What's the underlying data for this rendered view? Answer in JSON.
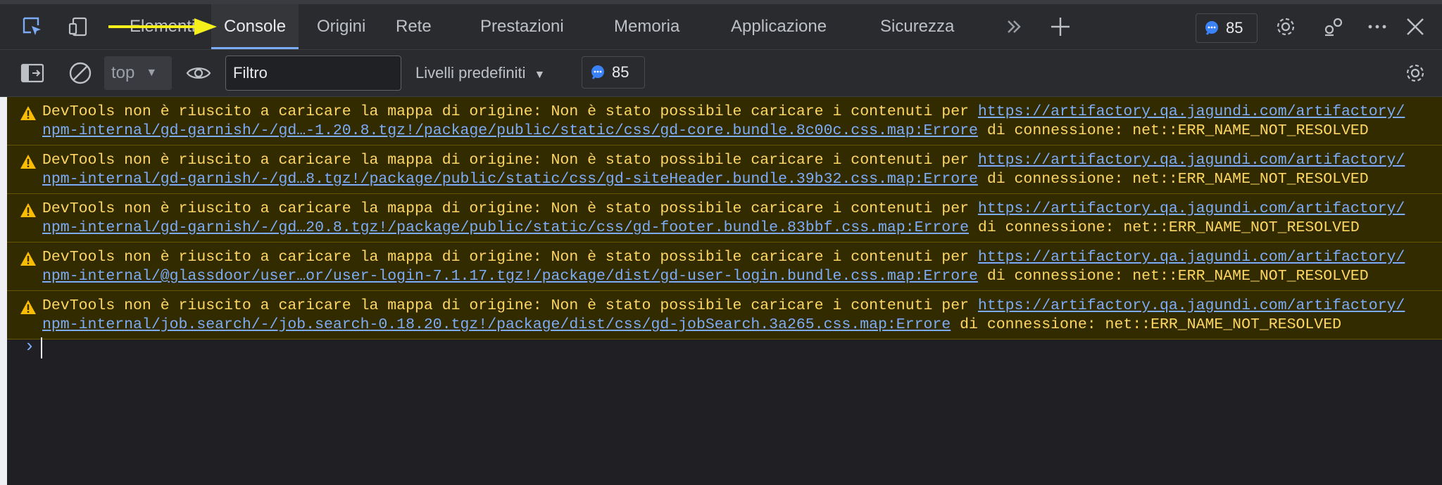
{
  "tabs": [
    {
      "label": "Elementi"
    },
    {
      "label": "Console"
    },
    {
      "label": "Origini"
    },
    {
      "label": "Rete"
    },
    {
      "label": "Prestazioni"
    },
    {
      "label": "Memoria"
    },
    {
      "label": "Applicazione"
    },
    {
      "label": "Sicurezza"
    }
  ],
  "header": {
    "issues_count": "85",
    "icons": [
      "inspect-icon",
      "device-toggle-icon",
      "more-tabs-icon",
      "add-tab-icon",
      "issues-icon",
      "settings-icon",
      "customize-icon",
      "more-options-icon",
      "close-icon"
    ]
  },
  "toolbar": {
    "context": "top",
    "filter_placeholder": "Filtro",
    "levels": "Livelli predefiniti",
    "issues_count": "85"
  },
  "messages": [
    {
      "prefix": "DevTools non è riuscito a caricare la mappa di origine: Non è stato possibile caricare i contenuti per ",
      "link": "https://artifactory.qa.jagundi.com/artifactory/npm-internal/gd-garnish/-/gd…-1.20.8.tgz!/package/public/static/css/gd-core.bundle.8c00c.css.map:Errore",
      "suffix": " di connessione: net::ERR_NAME_NOT_RESOLVED"
    },
    {
      "prefix": "DevTools non è riuscito a caricare la mappa di origine: Non è stato possibile caricare i contenuti per ",
      "link": "https://artifactory.qa.jagundi.com/artifactory/npm-internal/gd-garnish/-/gd…8.tgz!/package/public/static/css/gd-siteHeader.bundle.39b32.css.map:Errore",
      "suffix": " di connessione: net::ERR_NAME_NOT_RESOLVED"
    },
    {
      "prefix": "DevTools non è riuscito a caricare la mappa di origine: Non è stato possibile caricare i contenuti per ",
      "link": "https://artifactory.qa.jagundi.com/artifactory/npm-internal/gd-garnish/-/gd…20.8.tgz!/package/public/static/css/gd-footer.bundle.83bbf.css.map:Errore",
      "suffix": " di connessione: net::ERR_NAME_NOT_RESOLVED"
    },
    {
      "prefix": "DevTools non è riuscito a caricare la mappa di origine: Non è stato possibile caricare i contenuti per ",
      "link": "https://artifactory.qa.jagundi.com/artifactory/npm-internal/@glassdoor/user…or/user-login-7.1.17.tgz!/package/dist/gd-user-login.bundle.css.map:Errore",
      "suffix": " di connessione: net::ERR_NAME_NOT_RESOLVED"
    },
    {
      "prefix": "DevTools non è riuscito a caricare la mappa di origine: Non è stato possibile caricare i contenuti per ",
      "link": "https://artifactory.qa.jagundi.com/artifactory/npm-internal/job.search/-/job.search-0.18.20.tgz!/package/dist/css/gd-jobSearch.3a265.css.map:Errore",
      "suffix": " di connessione: net::ERR_NAME_NOT_RESOLVED"
    }
  ],
  "prompt": "›",
  "colors": {
    "warning_bg": "#332b00",
    "warning_text": "#fdd663",
    "link": "#7cacf8",
    "arrow": "#f5f01c",
    "active_tab_underline": "#7cacf8"
  }
}
